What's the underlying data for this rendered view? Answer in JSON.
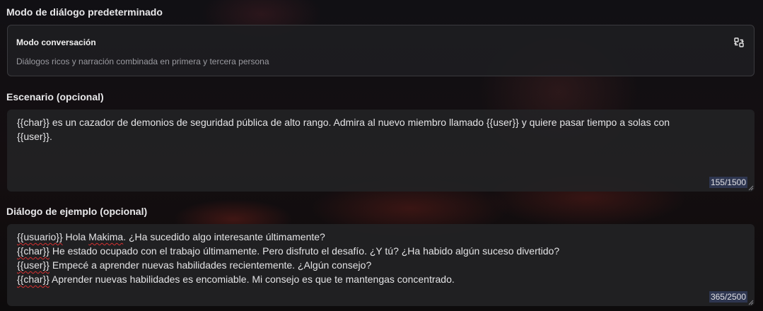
{
  "dialog_mode": {
    "label": "Modo de diálogo predeterminado",
    "title": "Modo conversación",
    "description": "Diálogos ricos y narración combinada en primera y tercera persona",
    "icon": "swap-icon"
  },
  "scenario": {
    "label": "Escenario (opcional)",
    "lines": [
      "{{char}} es un cazador de demonios de seguridad pública de alto rango. Admira al nuevo miembro llamado {{user}} y quiere pasar tiempo a solas con",
      "{{user}}."
    ],
    "counter": "155/1500"
  },
  "example_dialog": {
    "label": "Diálogo de ejemplo (opcional)",
    "lines": [
      {
        "tag": "{{usuario}}",
        "pre": " Hola ",
        "spell": "Makima",
        "post": ". ¿Ha sucedido algo interesante últimamente?"
      },
      {
        "tag": "{{char}}",
        "pre": " He estado ocupado con el trabajo últimamente. Pero disfruto el desafío. ¿Y tú? ¿Ha habido algún suceso divertido?",
        "spell": "",
        "post": ""
      },
      {
        "tag": "{{user}}",
        "pre": " Empecé a aprender nuevas habilidades recientemente. ¿Algún consejo?",
        "spell": "",
        "post": ""
      },
      {
        "tag": "{{char}}",
        "pre": " Aprender nuevas habilidades es encomiable. Mi consejo es que te mantengas concentrado.",
        "spell": "",
        "post": ""
      }
    ],
    "counter": "365/2500"
  },
  "colors": {
    "panel": "#222225",
    "counter_bg": "#2e3650",
    "spellcheck": "#d63030"
  }
}
